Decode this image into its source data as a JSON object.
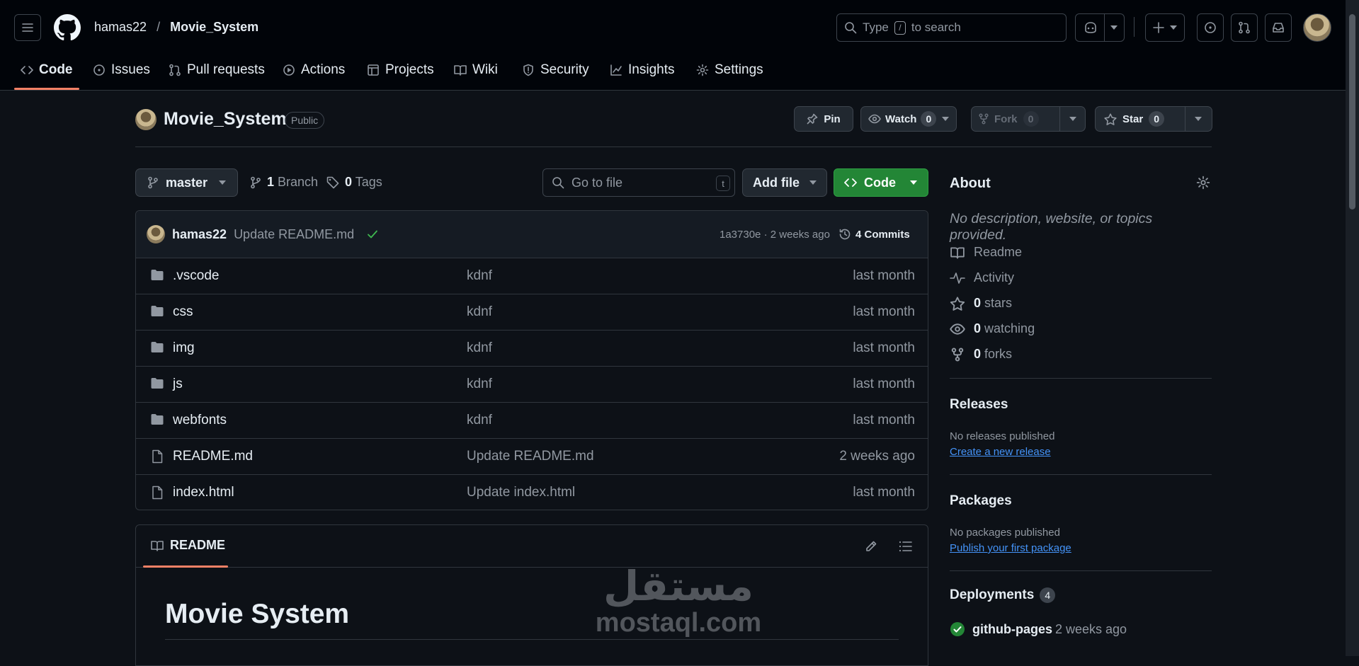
{
  "header": {
    "owner": "hamas22",
    "separator": "/",
    "repo": "Movie_System",
    "search_prefix": "Type",
    "search_key": "/",
    "search_suffix": "to search"
  },
  "tabs": [
    {
      "label": "Code",
      "icon": "code-icon",
      "active": true
    },
    {
      "label": "Issues",
      "icon": "issue-icon"
    },
    {
      "label": "Pull requests",
      "icon": "pull-request-icon"
    },
    {
      "label": "Actions",
      "icon": "play-icon"
    },
    {
      "label": "Projects",
      "icon": "table-icon"
    },
    {
      "label": "Wiki",
      "icon": "book-icon"
    },
    {
      "label": "Security",
      "icon": "shield-icon"
    },
    {
      "label": "Insights",
      "icon": "graph-icon"
    },
    {
      "label": "Settings",
      "icon": "gear-icon"
    }
  ],
  "repo_head": {
    "name": "Movie_System",
    "visibility": "Public",
    "pin": "Pin",
    "watch": "Watch",
    "watch_count": "0",
    "fork": "Fork",
    "fork_count": "0",
    "star": "Star",
    "star_count": "0"
  },
  "toolbar": {
    "branch": "master",
    "branch_count": "1",
    "branch_label": "Branch",
    "tag_count": "0",
    "tag_label": "Tags",
    "goto_placeholder": "Go to file",
    "goto_key": "t",
    "add_file": "Add file",
    "code": "Code"
  },
  "commit": {
    "author": "hamas22",
    "message": "Update README.md",
    "sha_time": "1a3730e · 2 weeks ago",
    "commits": "4 Commits"
  },
  "files": [
    {
      "name": ".vscode",
      "type": "folder",
      "message": "kdnf",
      "time": "last month"
    },
    {
      "name": "css",
      "type": "folder",
      "message": "kdnf",
      "time": "last month"
    },
    {
      "name": "img",
      "type": "folder",
      "message": "kdnf",
      "time": "last month"
    },
    {
      "name": "js",
      "type": "folder",
      "message": "kdnf",
      "time": "last month"
    },
    {
      "name": "webfonts",
      "type": "folder",
      "message": "kdnf",
      "time": "last month"
    },
    {
      "name": "README.md",
      "type": "file",
      "message": "Update README.md",
      "time": "2 weeks ago"
    },
    {
      "name": "index.html",
      "type": "file",
      "message": "Update index.html",
      "time": "last month"
    }
  ],
  "readme": {
    "tab": "README",
    "heading": "Movie System"
  },
  "watermark": {
    "arabic": "مستقل",
    "latin": "mostaql.com"
  },
  "about": {
    "title": "About",
    "description": "No description, website, or topics provided.",
    "readme": "Readme",
    "activity": "Activity",
    "stars_count": "0",
    "stars": "stars",
    "watching_count": "0",
    "watching": "watching",
    "forks_count": "0",
    "forks": "forks"
  },
  "releases": {
    "title": "Releases",
    "empty": "No releases published",
    "link": "Create a new release"
  },
  "packages": {
    "title": "Packages",
    "empty": "No packages published",
    "link": "Publish your first package"
  },
  "deployments": {
    "title": "Deployments",
    "count": "4",
    "name": "github-pages",
    "time": "2 weeks ago"
  },
  "colors": {
    "accent_orange": "#f78166",
    "green": "#238636",
    "link": "#4493f8",
    "success": "#3fb950"
  }
}
